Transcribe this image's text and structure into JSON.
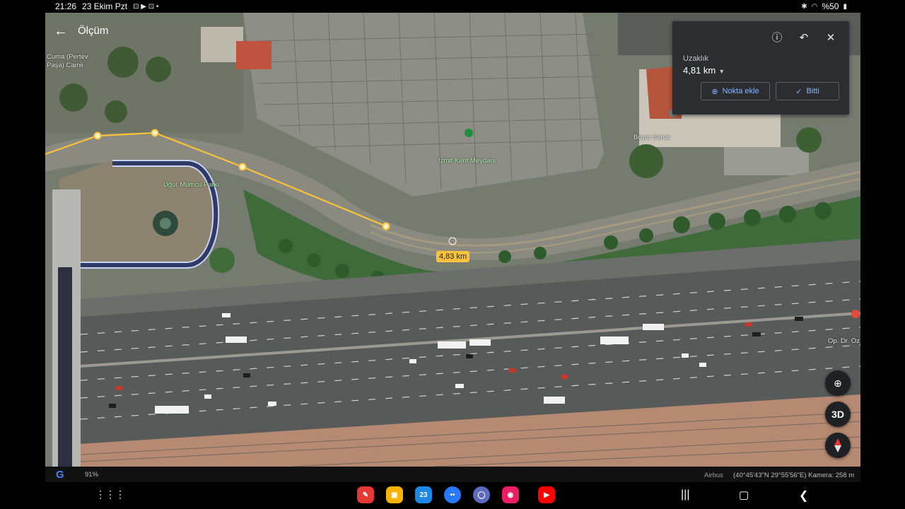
{
  "status_bar": {
    "time": "21:26",
    "date": "23 Ekim Pzt",
    "battery": "%50"
  },
  "header": {
    "title": "Ölçüm"
  },
  "measure_panel": {
    "distance_label": "Uzaklık",
    "distance_value": "4,81 km",
    "add_point_label": "Nokta ekle",
    "done_label": "Bitti"
  },
  "map": {
    "segment_label": "4,83 km",
    "places": {
      "park": "Uğur Mumcu Parkı",
      "square": "İzmit Kent Meydanı",
      "shop": "Boyut Sanat",
      "mosque_line1": "Cuma (Pertev",
      "mosque_line2": "Paşa) Camii",
      "clinic": "Op. Dr. Oz"
    },
    "controls": {
      "three_d_label": "3D"
    }
  },
  "info_strip": {
    "zoom": "91%",
    "attribution": "Airbus",
    "coordinates": "(40°45'43\"N 29°55'56\"E) Kamera: 258 m"
  },
  "colors": {
    "panel_bg": "#2c2d30",
    "accent": "#8ab4f8",
    "measure_line": "#f9c23c"
  }
}
